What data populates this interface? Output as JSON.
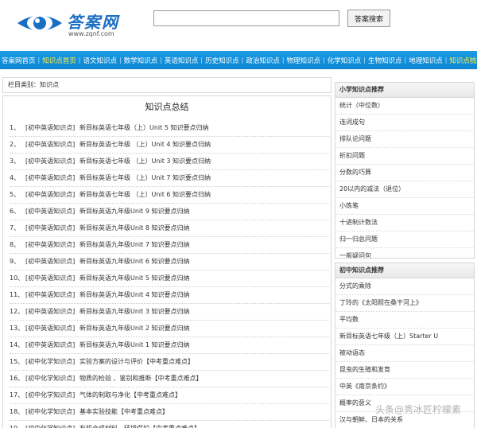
{
  "header": {
    "logo_title": "答案网",
    "logo_url": "www.zqnf.com",
    "search_placeholder": "",
    "search_button": "答案搜索"
  },
  "nav": [
    {
      "label": "答案网首页",
      "active": false
    },
    {
      "label": "知识点首页",
      "active": true
    },
    {
      "label": "语文知识点",
      "active": false
    },
    {
      "label": "数学知识点",
      "active": false
    },
    {
      "label": "英语知识点",
      "active": false
    },
    {
      "label": "历史知识点",
      "active": false
    },
    {
      "label": "政治知识点",
      "active": false
    },
    {
      "label": "物理知识点",
      "active": false
    },
    {
      "label": "化学知识点",
      "active": false
    },
    {
      "label": "生物知识点",
      "active": false
    },
    {
      "label": "地理知识点",
      "active": false
    },
    {
      "label": "知识点梳理",
      "active": true
    }
  ],
  "breadcrumb": "栏目类别：知识点",
  "main": {
    "title": "知识点总结",
    "items": [
      {
        "num": "1、",
        "cat": "[初中英语知识点]",
        "title": "新目标英语七年级（上）Unit 5 知识要点归纳"
      },
      {
        "num": "2、",
        "cat": "[初中英语知识点]",
        "title": "新目标英语七年级 （上）Unit 4 知识要点归纳"
      },
      {
        "num": "3、",
        "cat": "[初中英语知识点]",
        "title": "新目标英语七年级 （上）Unit 3 知识要点归纳"
      },
      {
        "num": "4、",
        "cat": "[初中英语知识点]",
        "title": "新目标英语七年级 （上）Unit 7 知识要点归纳"
      },
      {
        "num": "5、",
        "cat": "[初中英语知识点]",
        "title": "新目标英语七年级 （上）Unit 6 知识要点归纳"
      },
      {
        "num": "6、",
        "cat": "[初中英语知识点]",
        "title": "新目标英语九年级Unit 9 知识要点归纳"
      },
      {
        "num": "7、",
        "cat": "[初中英语知识点]",
        "title": "新目标英语九年级Unit 8 知识要点归纳"
      },
      {
        "num": "8、",
        "cat": "[初中英语知识点]",
        "title": "新目标英语九年级Unit 7 知识要点归纳"
      },
      {
        "num": "9、",
        "cat": "[初中英语知识点]",
        "title": "新目标英语九年级Unit 6 知识要点归纳"
      },
      {
        "num": "10、",
        "cat": "[初中英语知识点]",
        "title": "新目标英语九年级Unit 5 知识要点归纳"
      },
      {
        "num": "11、",
        "cat": "[初中英语知识点]",
        "title": "新目标英语九年级Unit 4 知识要点归纳"
      },
      {
        "num": "12、",
        "cat": "[初中英语知识点]",
        "title": "新目标英语九年级Unit 3 知识要点归纳"
      },
      {
        "num": "13、",
        "cat": "[初中英语知识点]",
        "title": "新目标英语九年级Unit 2 知识要点归纳"
      },
      {
        "num": "14、",
        "cat": "[初中英语知识点]",
        "title": "新目标英语九年级Unit 1 知识要点归纳"
      },
      {
        "num": "15、",
        "cat": "[初中化学知识点]",
        "title": "实验方案的设计与评价【中考重点难点】"
      },
      {
        "num": "16、",
        "cat": "[初中化学知识点]",
        "title": "物质的检验 、鉴别和推断【中考重点难点】"
      },
      {
        "num": "17、",
        "cat": "[初中化学知识点]",
        "title": "气体的制取与净化【中考重点难点】"
      },
      {
        "num": "18、",
        "cat": "[初中化学知识点]",
        "title": "基本实验技能【中考重点难点】"
      },
      {
        "num": "19、",
        "cat": "[初中化学知识点]",
        "title": "有机合成材料、环境保护【中考重点难点】"
      }
    ]
  },
  "sidebar1": {
    "heading": "小学知识点推荐",
    "items": [
      "统计（中位数）",
      "连词成句",
      "排队论问题",
      "折扣问题",
      "分数的巧算",
      "20以内的减法（退位）",
      "小炼笔",
      "十进制计数法",
      "归一归总问题",
      "一般疑问句"
    ]
  },
  "sidebar2": {
    "heading": "初中知识点推荐",
    "items": [
      "分式的乘除",
      "丁玲的《太阳照在桑干河上》",
      "平均数",
      "新目标英语七年级（上）Starter U",
      "被动语态",
      "昆虫的生殖和发育",
      "中英《南京条约》",
      "概率的意义",
      "汉与朝鲜、日本的关系"
    ]
  },
  "watermark": "头条@秀冰匠柠檬素"
}
